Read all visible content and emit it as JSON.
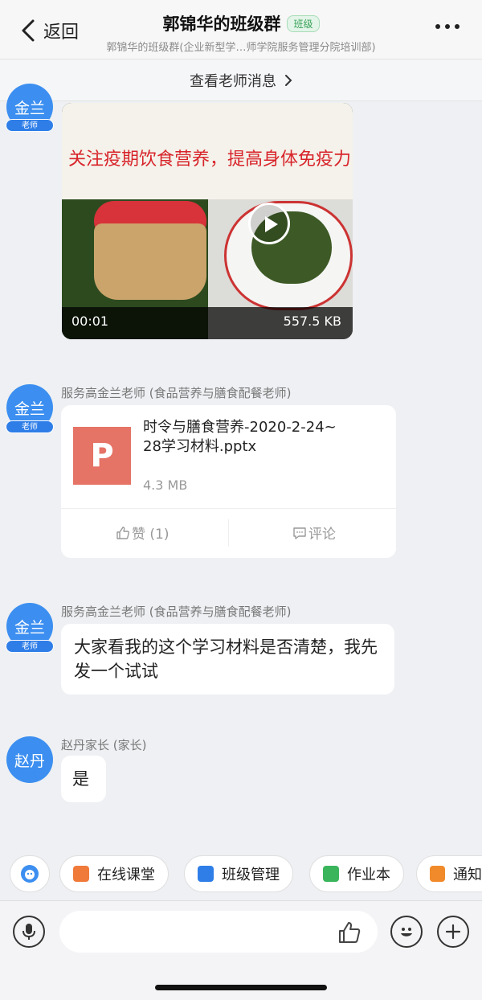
{
  "header": {
    "back_label": "返回",
    "title": "郭锦华的班级群",
    "badge": "班级",
    "subtitle": "郭锦华的班级群(企业新型学…师学院服务管理分院培训部)"
  },
  "teacher_bar": {
    "label": "查看老师消息"
  },
  "messages": [
    {
      "type": "video",
      "avatar": "金兰",
      "avatar_tag": "老师",
      "caption": "关注疫期饮食营养，提高身体免疫力",
      "duration": "00:01",
      "size": "557.5 KB"
    },
    {
      "type": "file",
      "sender": "服务高金兰老师 (食品营养与膳食配餐老师)",
      "avatar": "金兰",
      "avatar_tag": "老师",
      "file_icon": "P",
      "file_name": "时令与膳食营养-2020-2-24~28学习材料.pptx",
      "file_size": "4.3 MB",
      "like_label": "赞 (1)",
      "comment_label": "评论"
    },
    {
      "type": "text",
      "sender": "服务高金兰老师 (食品营养与膳食配餐老师)",
      "avatar": "金兰",
      "avatar_tag": "老师",
      "text": "大家看我的这个学习材料是否清楚，我先发一个试试"
    },
    {
      "type": "text",
      "sender": "赵丹家长 (家长)",
      "avatar": "赵丹",
      "text": "是"
    }
  ],
  "quickbar": [
    {
      "label": "在线课堂",
      "icon": "online-class-icon",
      "color": "#f07a3a"
    },
    {
      "label": "班级管理",
      "icon": "class-manage-icon",
      "color": "#2f7ee8"
    },
    {
      "label": "作业本",
      "icon": "homework-icon",
      "color": "#3bb55c"
    },
    {
      "label": "通知",
      "icon": "notice-icon",
      "color": "#f08a2a"
    }
  ],
  "input": {
    "placeholder": ""
  },
  "colors": {
    "accent": "#3c8ff0",
    "badge_green": "#3aa35a",
    "file_ppt": "#e57366"
  }
}
